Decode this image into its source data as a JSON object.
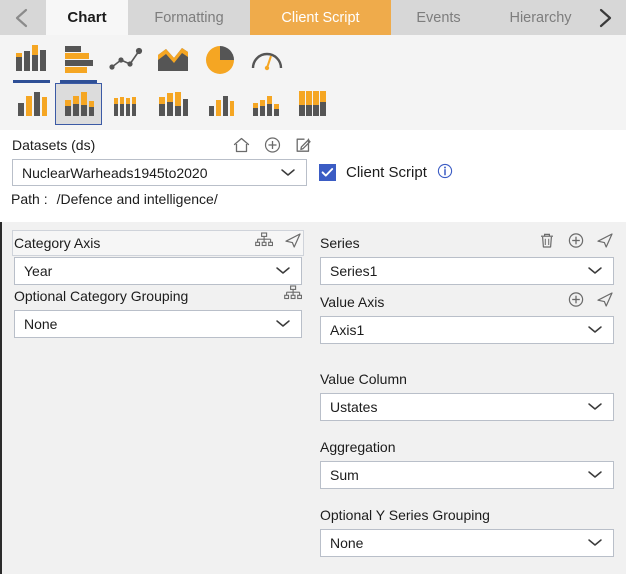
{
  "tabbar": {
    "prev_icon": "chevron-left-icon",
    "next_icon": "chevron-right-icon",
    "tabs": [
      {
        "label": "Chart",
        "state": "active-light"
      },
      {
        "label": "Formatting",
        "state": "inactive"
      },
      {
        "label": "Client Script",
        "state": "active-accent"
      },
      {
        "label": "Events",
        "state": "inactive"
      },
      {
        "label": "Hierarchy",
        "state": "inactive-clipped"
      }
    ],
    "accent_color": "#efab4b",
    "bar_color": "#d7d7d7"
  },
  "chart_types": {
    "row1": [
      {
        "name": "column-chart-icon",
        "selected": false,
        "underlined": true
      },
      {
        "name": "bar-chart-icon",
        "selected": false,
        "underlined": true
      },
      {
        "name": "line-chart-icon",
        "selected": false,
        "underlined": false
      },
      {
        "name": "area-chart-icon",
        "selected": false,
        "underlined": false
      },
      {
        "name": "pie-chart-icon",
        "selected": false,
        "underlined": false
      },
      {
        "name": "gauge-chart-icon",
        "selected": false,
        "underlined": false
      }
    ],
    "row2": [
      {
        "name": "grouped-column-icon",
        "selected": false
      },
      {
        "name": "stacked-column-icon",
        "selected": true
      },
      {
        "name": "stacked-column-thin-icon",
        "selected": false
      },
      {
        "name": "stacked-column-wide-icon",
        "selected": false
      },
      {
        "name": "column-small-icon",
        "selected": false
      },
      {
        "name": "stacked-column-mixed-icon",
        "selected": false
      },
      {
        "name": "stacked-column-tall-icon",
        "selected": false
      }
    ],
    "bar_orange": "#f5a623",
    "bar_dark": "#555555",
    "underline_color": "#2e4f96",
    "selected_border": "#3b5aa5"
  },
  "datasets": {
    "label": "Datasets (ds)",
    "icons": [
      {
        "name": "home-icon"
      },
      {
        "name": "add-circle-icon"
      },
      {
        "name": "edit-icon"
      }
    ],
    "value": "NuclearWarheads1945to2020",
    "path_label": "Path :",
    "path_value": "/Defence and intelligence/"
  },
  "client_script": {
    "checked": true,
    "label": "Client Script",
    "info_icon": "info-icon",
    "checkbox_color": "#3b5cc4"
  },
  "left_panel": {
    "category_axis": {
      "label": "Category Axis",
      "icons": [
        {
          "name": "hierarchy-icon"
        },
        {
          "name": "send-icon"
        }
      ],
      "value": "Year"
    },
    "optional_category_grouping": {
      "label": "Optional Category Grouping",
      "icons": [
        {
          "name": "hierarchy-icon"
        }
      ],
      "value": "None"
    }
  },
  "right_panel": {
    "series": {
      "label": "Series",
      "icons": [
        {
          "name": "delete-icon"
        },
        {
          "name": "add-circle-icon"
        },
        {
          "name": "send-icon"
        }
      ],
      "value": "Series1"
    },
    "value_axis": {
      "label": "Value Axis",
      "icons": [
        {
          "name": "add-circle-icon"
        },
        {
          "name": "send-icon"
        }
      ],
      "value": "Axis1"
    },
    "value_column": {
      "label": "Value Column",
      "icons": [],
      "value": "Ustates"
    },
    "aggregation": {
      "label": "Aggregation",
      "icons": [],
      "value": "Sum"
    },
    "optional_y_series_grouping": {
      "label": "Optional Y Series Grouping",
      "icons": [],
      "value": "None"
    }
  }
}
